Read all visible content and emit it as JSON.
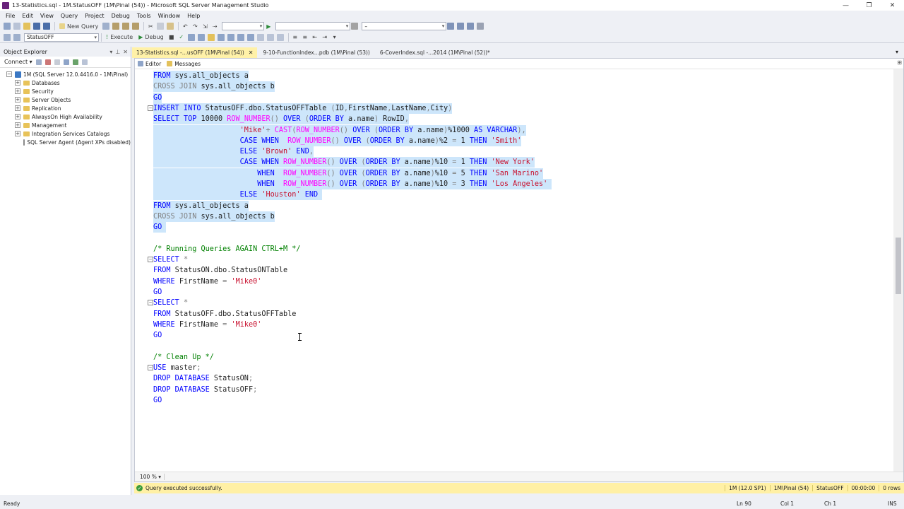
{
  "window": {
    "title": "13-Statistics.sql - 1M.StatusOFF (1M\\Pinal (54)) - Microsoft SQL Server Management Studio",
    "controls": [
      "—",
      "❐",
      "✕"
    ]
  },
  "menu": [
    "File",
    "Edit",
    "View",
    "Query",
    "Project",
    "Debug",
    "Tools",
    "Window",
    "Help"
  ],
  "toolbar": {
    "new_query": "New Query",
    "database": "StatusOFF",
    "execute": "Execute",
    "debug": "Debug",
    "search_value": "–"
  },
  "object_explorer": {
    "title": "Object Explorer",
    "connect": "Connect ▾",
    "nodes": [
      {
        "label": "1M (SQL Server 12.0.4416.0 - 1M\\Pinal)",
        "kind": "server",
        "level": 0,
        "expander": "−"
      },
      {
        "label": "Databases",
        "kind": "folder",
        "level": 1,
        "expander": "+"
      },
      {
        "label": "Security",
        "kind": "folder",
        "level": 1,
        "expander": "+"
      },
      {
        "label": "Server Objects",
        "kind": "folder",
        "level": 1,
        "expander": "+"
      },
      {
        "label": "Replication",
        "kind": "folder",
        "level": 1,
        "expander": "+"
      },
      {
        "label": "AlwaysOn High Availability",
        "kind": "folder",
        "level": 1,
        "expander": "+"
      },
      {
        "label": "Management",
        "kind": "folder",
        "level": 1,
        "expander": "+"
      },
      {
        "label": "Integration Services Catalogs",
        "kind": "folder",
        "level": 1,
        "expander": "+"
      },
      {
        "label": "SQL Server Agent (Agent XPs disabled)",
        "kind": "agent",
        "level": 1,
        "expander": ""
      }
    ]
  },
  "tabs": [
    {
      "label": "13-Statistics.sql -...usOFF (1M\\Pinal (54))",
      "active": true,
      "close": "✕"
    },
    {
      "label": "9-10-FunctionIndex...pdb (1M\\Pinal (53))",
      "active": false,
      "close": ""
    },
    {
      "label": "6-CoverIndex.sql -...2014 (1M\\Pinal (52))*",
      "active": false,
      "close": ""
    }
  ],
  "result_tabs": {
    "editor": "Editor",
    "messages": "Messages"
  },
  "code_lines": [
    {
      "sel": true,
      "fold": "",
      "tokens": [
        [
          "kw",
          "FROM "
        ],
        [
          "obj",
          "sys.all_objects a"
        ]
      ]
    },
    {
      "sel": true,
      "fold": "",
      "tokens": [
        [
          "gray",
          "CROSS JOIN "
        ],
        [
          "obj",
          "sys.all_objects b"
        ]
      ]
    },
    {
      "sel": true,
      "fold": "",
      "tokens": [
        [
          "kw",
          "GO"
        ]
      ]
    },
    {
      "sel": true,
      "fold": "⊟",
      "tokens": [
        [
          "kw",
          "INSERT INTO "
        ],
        [
          "obj",
          "StatusOFF.dbo.StatusOFFTable "
        ],
        [
          "gray",
          "("
        ],
        [
          "obj",
          "ID"
        ],
        [
          "gray",
          ","
        ],
        [
          "obj",
          "FirstName"
        ],
        [
          "gray",
          ","
        ],
        [
          "obj",
          "LastName"
        ],
        [
          "gray",
          ","
        ],
        [
          "obj",
          "City"
        ],
        [
          "gray",
          ")"
        ]
      ]
    },
    {
      "sel": true,
      "fold": "",
      "tokens": [
        [
          "kw",
          "SELECT TOP "
        ],
        [
          "obj",
          "10000 "
        ],
        [
          "fn",
          "ROW_NUMBER"
        ],
        [
          "gray",
          "() "
        ],
        [
          "kw",
          "OVER "
        ],
        [
          "gray",
          "("
        ],
        [
          "kw",
          "ORDER BY "
        ],
        [
          "obj",
          "a.name"
        ],
        [
          "gray",
          ") "
        ],
        [
          "obj",
          "RowID"
        ],
        [
          "gray",
          ","
        ]
      ]
    },
    {
      "sel": true,
      "fold": "",
      "tokens": [
        [
          "obj",
          "                    "
        ],
        [
          "str",
          "'Mike'"
        ],
        [
          "gray",
          "+ "
        ],
        [
          "fn",
          "CAST"
        ],
        [
          "gray",
          "("
        ],
        [
          "fn",
          "ROW_NUMBER"
        ],
        [
          "gray",
          "() "
        ],
        [
          "kw",
          "OVER "
        ],
        [
          "gray",
          "("
        ],
        [
          "kw",
          "ORDER BY "
        ],
        [
          "obj",
          "a.name"
        ],
        [
          "gray",
          ")"
        ],
        [
          "obj",
          "%1000 "
        ],
        [
          "kw",
          "AS VARCHAR"
        ],
        [
          "gray",
          "),"
        ]
      ]
    },
    {
      "sel": true,
      "fold": "",
      "tokens": [
        [
          "obj",
          "                    "
        ],
        [
          "kw",
          "CASE WHEN  "
        ],
        [
          "fn",
          "ROW_NUMBER"
        ],
        [
          "gray",
          "() "
        ],
        [
          "kw",
          "OVER "
        ],
        [
          "gray",
          "("
        ],
        [
          "kw",
          "ORDER BY "
        ],
        [
          "obj",
          "a.name"
        ],
        [
          "gray",
          ")"
        ],
        [
          "obj",
          "%2 "
        ],
        [
          "gray",
          "= "
        ],
        [
          "obj",
          "1 "
        ],
        [
          "kw",
          "THEN "
        ],
        [
          "str",
          "'Smith'"
        ]
      ]
    },
    {
      "sel": true,
      "fold": "",
      "tokens": [
        [
          "obj",
          "                    "
        ],
        [
          "kw",
          "ELSE "
        ],
        [
          "str",
          "'Brown' "
        ],
        [
          "kw",
          "END"
        ],
        [
          "gray",
          ","
        ]
      ]
    },
    {
      "sel": true,
      "fold": "",
      "tokens": [
        [
          "obj",
          "                    "
        ],
        [
          "kw",
          "CASE WHEN "
        ],
        [
          "fn",
          "ROW_NUMBER"
        ],
        [
          "gray",
          "() "
        ],
        [
          "kw",
          "OVER "
        ],
        [
          "gray",
          "("
        ],
        [
          "kw",
          "ORDER BY "
        ],
        [
          "obj",
          "a.name"
        ],
        [
          "gray",
          ")"
        ],
        [
          "obj",
          "%10 "
        ],
        [
          "gray",
          "= "
        ],
        [
          "obj",
          "1 "
        ],
        [
          "kw",
          "THEN "
        ],
        [
          "str",
          "'New York'"
        ]
      ]
    },
    {
      "sel": true,
      "fold": "",
      "tokens": [
        [
          "obj",
          "                        "
        ],
        [
          "kw",
          "WHEN  "
        ],
        [
          "fn",
          "ROW_NUMBER"
        ],
        [
          "gray",
          "() "
        ],
        [
          "kw",
          "OVER "
        ],
        [
          "gray",
          "("
        ],
        [
          "kw",
          "ORDER BY "
        ],
        [
          "obj",
          "a.name"
        ],
        [
          "gray",
          ")"
        ],
        [
          "obj",
          "%10 "
        ],
        [
          "gray",
          "= "
        ],
        [
          "obj",
          "5 "
        ],
        [
          "kw",
          "THEN "
        ],
        [
          "str",
          "'San Marino'"
        ]
      ]
    },
    {
      "sel": true,
      "fold": "",
      "tokens": [
        [
          "obj",
          "                        "
        ],
        [
          "kw",
          "WHEN  "
        ],
        [
          "fn",
          "ROW_NUMBER"
        ],
        [
          "gray",
          "() "
        ],
        [
          "kw",
          "OVER "
        ],
        [
          "gray",
          "("
        ],
        [
          "kw",
          "ORDER BY "
        ],
        [
          "obj",
          "a.name"
        ],
        [
          "gray",
          ")"
        ],
        [
          "obj",
          "%10 "
        ],
        [
          "gray",
          "= "
        ],
        [
          "obj",
          "3 "
        ],
        [
          "kw",
          "THEN "
        ],
        [
          "str",
          "'Los Angeles' "
        ]
      ]
    },
    {
      "sel": true,
      "fold": "",
      "tokens": [
        [
          "obj",
          "                    "
        ],
        [
          "kw",
          "ELSE "
        ],
        [
          "str",
          "'Houston' "
        ],
        [
          "kw",
          "END "
        ]
      ]
    },
    {
      "sel": true,
      "fold": "",
      "tokens": [
        [
          "kw",
          "FROM "
        ],
        [
          "obj",
          "sys.all_objects a"
        ]
      ]
    },
    {
      "sel": true,
      "fold": "",
      "tokens": [
        [
          "gray",
          "CROSS JOIN "
        ],
        [
          "obj",
          "sys.all_objects b"
        ]
      ]
    },
    {
      "sel": true,
      "fold": "",
      "tokens": [
        [
          "kw",
          "GO "
        ]
      ]
    },
    {
      "sel": false,
      "fold": "",
      "tokens": []
    },
    {
      "sel": false,
      "fold": "",
      "tokens": [
        [
          "cmt",
          "/* Running Queries AGAIN CTRL+M */"
        ]
      ]
    },
    {
      "sel": false,
      "fold": "⊟",
      "tokens": [
        [
          "kw",
          "SELECT "
        ],
        [
          "gray",
          "*"
        ]
      ]
    },
    {
      "sel": false,
      "fold": "",
      "tokens": [
        [
          "kw",
          "FROM "
        ],
        [
          "obj",
          "StatusON.dbo.StatusONTable"
        ]
      ]
    },
    {
      "sel": false,
      "fold": "",
      "tokens": [
        [
          "kw",
          "WHERE "
        ],
        [
          "obj",
          "FirstName "
        ],
        [
          "gray",
          "= "
        ],
        [
          "str",
          "'Mike0'"
        ]
      ]
    },
    {
      "sel": false,
      "fold": "",
      "tokens": [
        [
          "kw",
          "GO"
        ]
      ]
    },
    {
      "sel": false,
      "fold": "⊟",
      "tokens": [
        [
          "kw",
          "SELECT "
        ],
        [
          "gray",
          "*"
        ]
      ]
    },
    {
      "sel": false,
      "fold": "",
      "tokens": [
        [
          "kw",
          "FROM "
        ],
        [
          "obj",
          "StatusOFF.dbo.StatusOFFTable"
        ]
      ]
    },
    {
      "sel": false,
      "fold": "",
      "tokens": [
        [
          "kw",
          "WHERE "
        ],
        [
          "obj",
          "FirstName "
        ],
        [
          "gray",
          "= "
        ],
        [
          "str",
          "'Mike0'"
        ]
      ]
    },
    {
      "sel": false,
      "fold": "",
      "tokens": [
        [
          "kw",
          "GO"
        ]
      ]
    },
    {
      "sel": false,
      "fold": "",
      "tokens": []
    },
    {
      "sel": false,
      "fold": "",
      "tokens": [
        [
          "cmt",
          "/* Clean Up */"
        ]
      ]
    },
    {
      "sel": false,
      "fold": "⊟",
      "tokens": [
        [
          "kw",
          "USE "
        ],
        [
          "obj",
          "master"
        ],
        [
          "gray",
          ";"
        ]
      ]
    },
    {
      "sel": false,
      "fold": "",
      "tokens": [
        [
          "kw",
          "DROP DATABASE "
        ],
        [
          "obj",
          "StatusON"
        ],
        [
          "gray",
          ";"
        ]
      ]
    },
    {
      "sel": false,
      "fold": "",
      "tokens": [
        [
          "kw",
          "DROP DATABASE "
        ],
        [
          "obj",
          "StatusOFF"
        ],
        [
          "gray",
          ";"
        ]
      ]
    },
    {
      "sel": false,
      "fold": "",
      "tokens": [
        [
          "kw",
          "GO"
        ]
      ]
    }
  ],
  "zoom": "100 %",
  "query_status": {
    "message": "Query executed successfully.",
    "server": "1M (12.0 SP1)",
    "login": "1M\\Pinal (54)",
    "database": "StatusOFF",
    "time": "00:00:00",
    "rows": "0 rows"
  },
  "statusbar": {
    "ready": "Ready",
    "ln": "Ln 90",
    "col": "Col 1",
    "ch": "Ch 1",
    "ins": "INS"
  },
  "colors": {
    "selection": "#cde6fb",
    "keyword": "#0000ff",
    "string": "#c8102e",
    "function": "#ff00ff",
    "comment": "#008000",
    "active_tab": "#fff1a8",
    "query_status_bg": "#fff0a5"
  }
}
